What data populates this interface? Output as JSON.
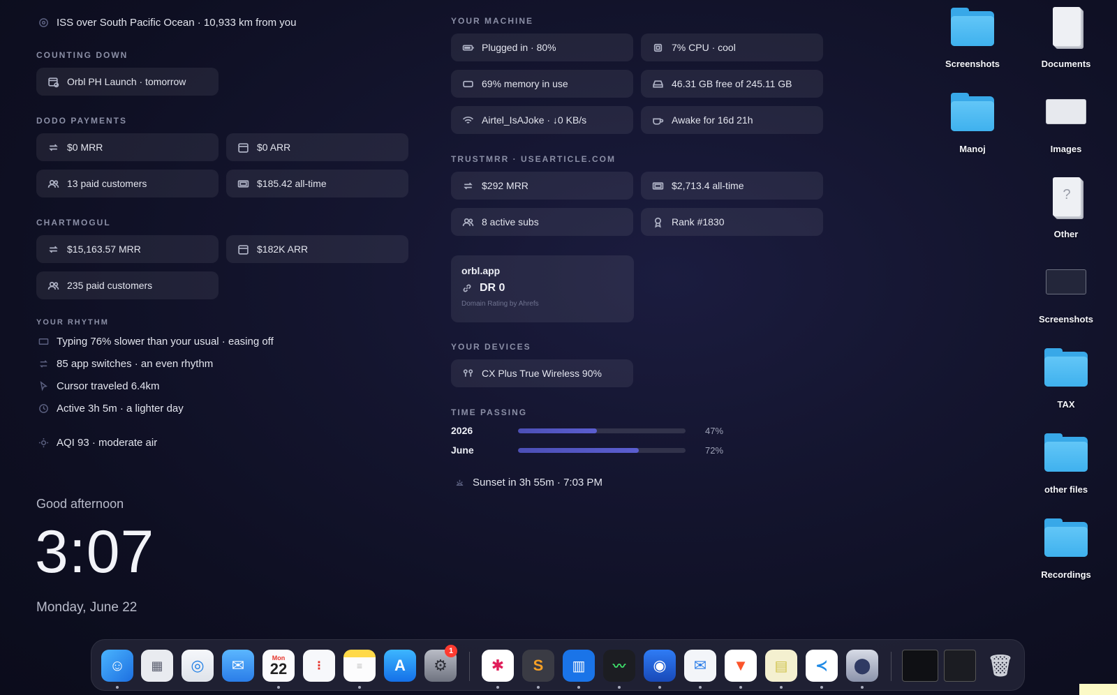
{
  "iss": {
    "text": "ISS over South Pacific Ocean · 10,933 km from you",
    "icon": "satellite-icon"
  },
  "counting_down": {
    "title": "COUNTING DOWN",
    "item": "Orbl PH Launch · tomorrow",
    "icon": "calendar-clock-icon"
  },
  "dodo_payments": {
    "title": "DODO PAYMENTS",
    "items": [
      {
        "label": "$0 MRR",
        "icon": "repeat-icon"
      },
      {
        "label": "$0 ARR",
        "icon": "calendar-icon"
      },
      {
        "label": "13 paid customers",
        "icon": "users-icon"
      },
      {
        "label": "$185.42 all-time",
        "icon": "cash-icon"
      }
    ]
  },
  "chartmogul": {
    "title": "CHARTMOGUL",
    "items": [
      {
        "label": "$15,163.57 MRR",
        "icon": "repeat-icon"
      },
      {
        "label": "$182K ARR",
        "icon": "calendar-icon"
      },
      {
        "label": "235 paid customers",
        "icon": "users-icon"
      }
    ]
  },
  "rhythm": {
    "title": "YOUR RHYTHM",
    "items": [
      {
        "label": "Typing 76% slower than your usual · easing off",
        "icon": "keyboard-icon"
      },
      {
        "label": "85 app switches · an even rhythm",
        "icon": "switch-icon"
      },
      {
        "label": "Cursor traveled 6.4km",
        "icon": "cursor-icon"
      },
      {
        "label": "Active 3h 5m · a lighter day",
        "icon": "clock-icon"
      }
    ],
    "aqi": {
      "label": "AQI 93 · moderate air",
      "icon": "air-icon"
    }
  },
  "greeting": "Good afternoon",
  "clock": "3:07",
  "date": "Monday, June 22",
  "machine": {
    "title": "YOUR MACHINE",
    "items": [
      {
        "label": "Plugged in · 80%",
        "icon": "battery-icon"
      },
      {
        "label": "7% CPU · cool",
        "icon": "cpu-icon"
      },
      {
        "label": "69% memory in use",
        "icon": "memory-icon"
      },
      {
        "label": "46.31 GB free of 245.11 GB",
        "icon": "disk-icon"
      },
      {
        "label": "Airtel_IsAJoke · ↓0 KB/s",
        "icon": "wifi-icon"
      },
      {
        "label": "Awake for 16d 21h",
        "icon": "coffee-icon"
      }
    ]
  },
  "trustmrr": {
    "title": "TRUSTMRR · USEARTICLE.COM",
    "items": [
      {
        "label": "$292 MRR",
        "icon": "repeat-icon"
      },
      {
        "label": "$2,713.4 all-time",
        "icon": "cash-icon"
      },
      {
        "label": "8 active subs",
        "icon": "users-icon"
      },
      {
        "label": "Rank #1830",
        "icon": "award-icon"
      }
    ]
  },
  "domain_card": {
    "domain": "orbl.app",
    "dr": "DR 0",
    "sub": "Domain Rating by Ahrefs"
  },
  "devices": {
    "title": "YOUR DEVICES",
    "item": "CX Plus True Wireless 90%",
    "icon": "earbuds-icon"
  },
  "time_passing": {
    "title": "TIME PASSING",
    "rows": [
      {
        "label": "2026",
        "percent": 47,
        "percent_text": "47%"
      },
      {
        "label": "June",
        "percent": 72,
        "percent_text": "72%"
      }
    ]
  },
  "sunset": {
    "label": "Sunset in 3h 55m · 7:03 PM",
    "icon": "sunset-icon"
  },
  "desktop": [
    {
      "label": "Screenshots",
      "kind": "folder"
    },
    {
      "label": "Documents",
      "kind": "paper"
    },
    {
      "label": "Manoj",
      "kind": "folder"
    },
    {
      "label": "Images",
      "kind": "thumb"
    },
    {
      "label": "Other",
      "kind": "paper-q"
    },
    {
      "label": "Screenshots",
      "kind": "thumb-dark"
    },
    {
      "label": "TAX",
      "kind": "folder"
    },
    {
      "label": "other files",
      "kind": "folder"
    },
    {
      "label": "Recordings",
      "kind": "folder"
    }
  ],
  "dock": {
    "calendar_month": "Mon",
    "calendar_day": "22",
    "settings_badge": "1",
    "apps": [
      "finder",
      "launchpad",
      "safari",
      "mail",
      "calendar",
      "reminders",
      "notes",
      "app-store",
      "system-settings",
      "slack",
      "sublime-text",
      "trello",
      "activity-monitor",
      "thunderbird",
      "mailspring",
      "brave",
      "stickies",
      "vscode",
      "disk-utility",
      "terminal-window",
      "screenshot-window",
      "trash"
    ]
  },
  "colors": {
    "accent_bar": "#5b5ed0",
    "folder": "#3fb1ee",
    "badge": "#ff3b30"
  }
}
